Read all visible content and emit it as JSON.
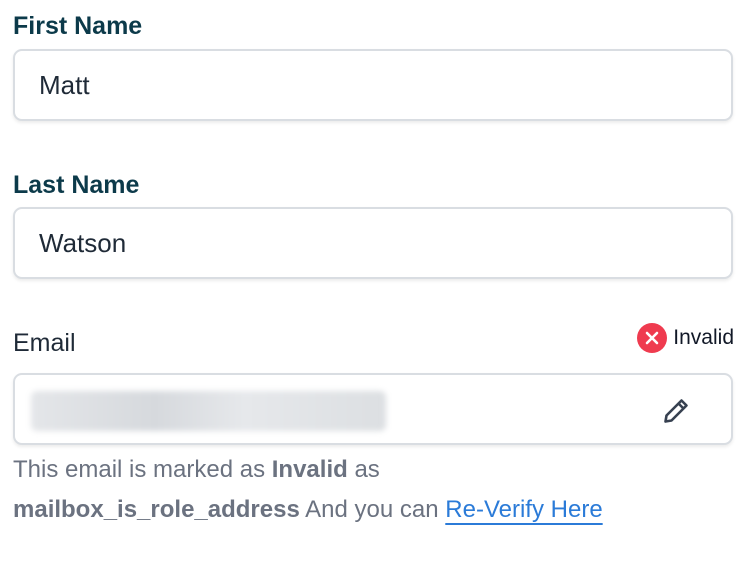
{
  "first_name": {
    "label": "First Name",
    "value": "Matt"
  },
  "last_name": {
    "label": "Last Name",
    "value": "Watson"
  },
  "email": {
    "label": "Email",
    "value": "",
    "status": {
      "text": "Invalid",
      "icon": "close-circle-icon",
      "color": "#ef3b4f"
    },
    "edit_icon": "pencil-icon"
  },
  "help": {
    "text_1": "This email is marked as ",
    "status_word": "Invalid",
    "text_2": " as",
    "reason": "mailbox_is_role_address",
    "text_3": " And you can ",
    "link_label": "Re-Verify Here",
    "link_color": "#2b7bd8"
  }
}
